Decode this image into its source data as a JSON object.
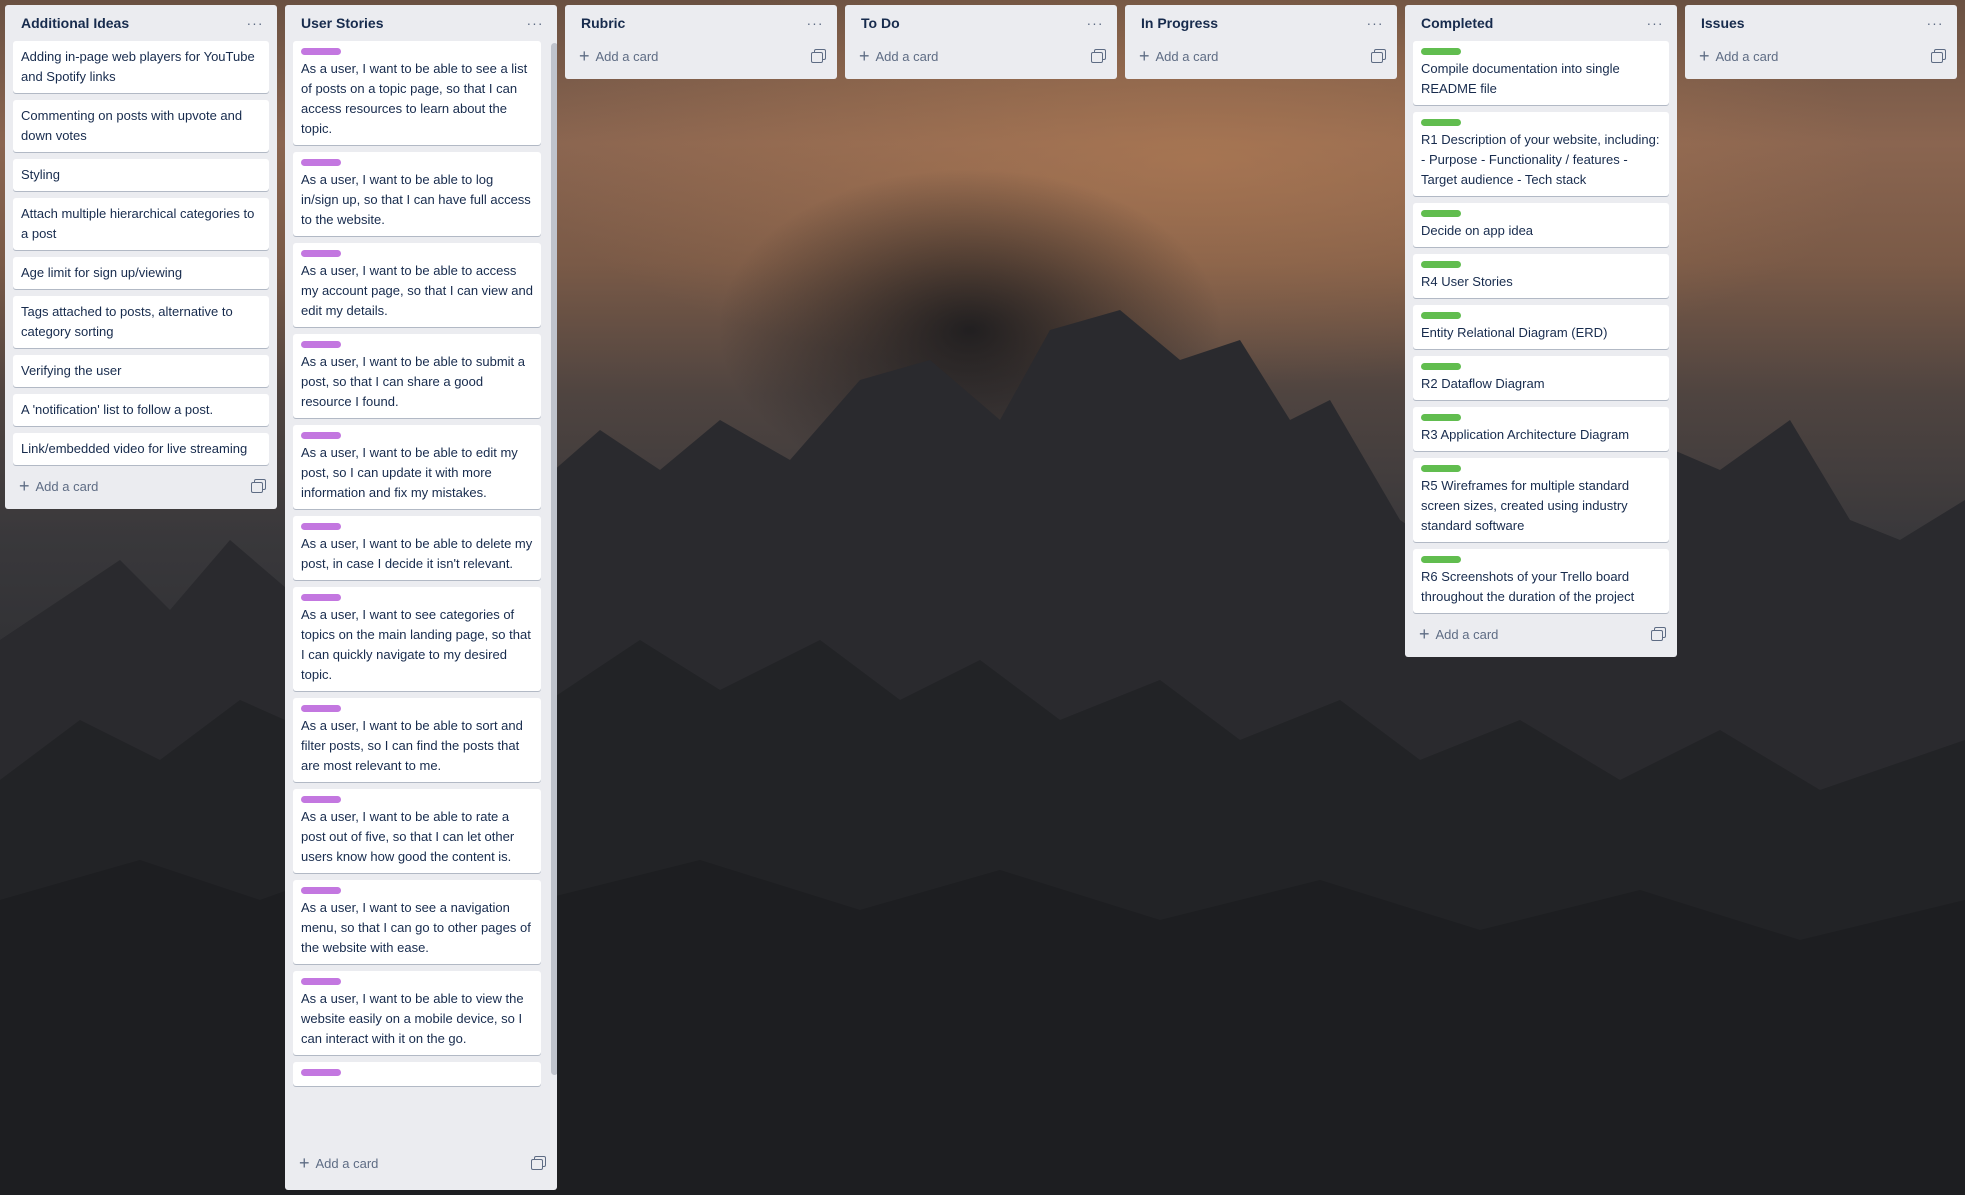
{
  "board": {
    "add_card_label": "Add a card",
    "menu_glyph": "···",
    "lists": [
      {
        "title": "Additional Ideas",
        "cards": [
          {
            "text": "Adding in-page web players for YouTube and Spotify links"
          },
          {
            "text": "Commenting on posts with upvote and down votes"
          },
          {
            "text": "Styling"
          },
          {
            "text": "Attach multiple hierarchical categories to a post"
          },
          {
            "text": "Age limit for sign up/viewing"
          },
          {
            "text": "Tags attached to posts, alternative to category sorting"
          },
          {
            "text": "Verifying the user"
          },
          {
            "text": "A 'notification' list to follow a post."
          },
          {
            "text": "Link/embedded video for live streaming"
          }
        ]
      },
      {
        "title": "User Stories",
        "label_color": "#c377e0",
        "cards": [
          {
            "text": "As a user, I want to be able to see a list of posts on a topic page, so that I can access resources to learn about the topic."
          },
          {
            "text": "As a user, I want to be able to log in/sign up, so that I can have full access to the website."
          },
          {
            "text": "As a user, I want to be able to access my account page, so that I can view and edit my details."
          },
          {
            "text": "As a user, I want to be able to submit a post, so that I can share a good resource I found."
          },
          {
            "text": "As a user, I want to be able to edit my post, so I can update it with more information and fix my mistakes."
          },
          {
            "text": "As a user, I want to be able to delete my post, in case I decide it isn't relevant."
          },
          {
            "text": "As a user, I want to see categories of topics on the main landing page, so that I can quickly navigate to my desired topic."
          },
          {
            "text": "As a user, I want to be able to sort and filter posts, so I can find the posts that are most relevant to me."
          },
          {
            "text": "As a user, I want to be able to rate a post out of five, so that I can let other users know how good the content is."
          },
          {
            "text": "As a user, I want to see a navigation menu, so that I can go to other pages of the website with ease."
          },
          {
            "text": "As a user, I want to be able to view the website easily on a mobile device, so I can interact with it on the go."
          },
          {
            "text": ""
          }
        ]
      },
      {
        "title": "Rubric",
        "cards": []
      },
      {
        "title": "To Do",
        "cards": []
      },
      {
        "title": "In Progress",
        "cards": []
      },
      {
        "title": "Completed",
        "label_color": "#61bd4f",
        "cards": [
          {
            "text": "Compile documentation into single README file"
          },
          {
            "text": "R1 Description of your website, including: - Purpose - Functionality / features - Target audience - Tech stack"
          },
          {
            "text": "Decide on app idea"
          },
          {
            "text": "R4 User Stories"
          },
          {
            "text": "Entity Relational Diagram (ERD)"
          },
          {
            "text": "R2 Dataflow Diagram"
          },
          {
            "text": "R3 Application Architecture Diagram"
          },
          {
            "text": "R5 Wireframes for multiple standard screen sizes, created using industry standard software"
          },
          {
            "text": "R6 Screenshots of your Trello board throughout the duration of the project"
          }
        ]
      },
      {
        "title": "Issues",
        "cards": []
      }
    ]
  }
}
